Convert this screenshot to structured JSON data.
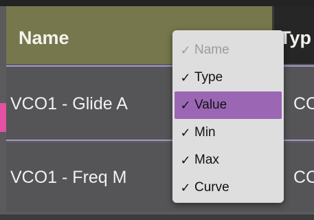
{
  "table": {
    "columns": [
      {
        "label": "Name",
        "sort_icon": "sort-arrow-icon"
      },
      {
        "label": "Typ"
      }
    ],
    "rows": [
      {
        "name": "VCO1 - Glide A",
        "type": "CC"
      },
      {
        "name": "VCO1 - Freq M",
        "type": "CC"
      }
    ]
  },
  "column_menu": {
    "items": [
      {
        "label": "Name",
        "checked": true,
        "enabled": false,
        "selected": false
      },
      {
        "label": "Type",
        "checked": true,
        "enabled": true,
        "selected": false
      },
      {
        "label": "Value",
        "checked": true,
        "enabled": true,
        "selected": true
      },
      {
        "label": "Min",
        "checked": true,
        "enabled": true,
        "selected": false
      },
      {
        "label": "Max",
        "checked": true,
        "enabled": true,
        "selected": false
      },
      {
        "label": "Curve",
        "checked": true,
        "enabled": true,
        "selected": false
      }
    ],
    "check_glyph": "✓"
  },
  "colors": {
    "header_active": "#77774d",
    "selection_border": "#aa97c8",
    "menu_highlight": "#9b67b5",
    "row_marker": "#e451a4"
  }
}
